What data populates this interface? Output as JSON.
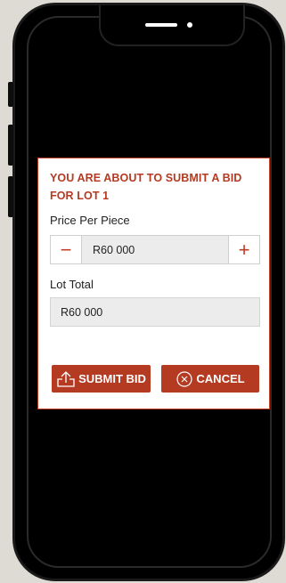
{
  "modal": {
    "title": "YOU ARE ABOUT TO SUBMIT A BID FOR LOT 1",
    "price_label": "Price Per Piece",
    "price_value": "R60 000",
    "decrement": "−",
    "increment": "+",
    "lot_total_label": "Lot Total",
    "lot_total_value": "R60 000",
    "submit_label": "SUBMIT BID",
    "cancel_label": "CANCEL"
  },
  "colors": {
    "accent": "#b53a22",
    "field_bg": "#ececec",
    "page_bg": "#dedbd4"
  },
  "icons": {
    "submit": "upload-icon",
    "cancel": "close-circle-icon"
  }
}
